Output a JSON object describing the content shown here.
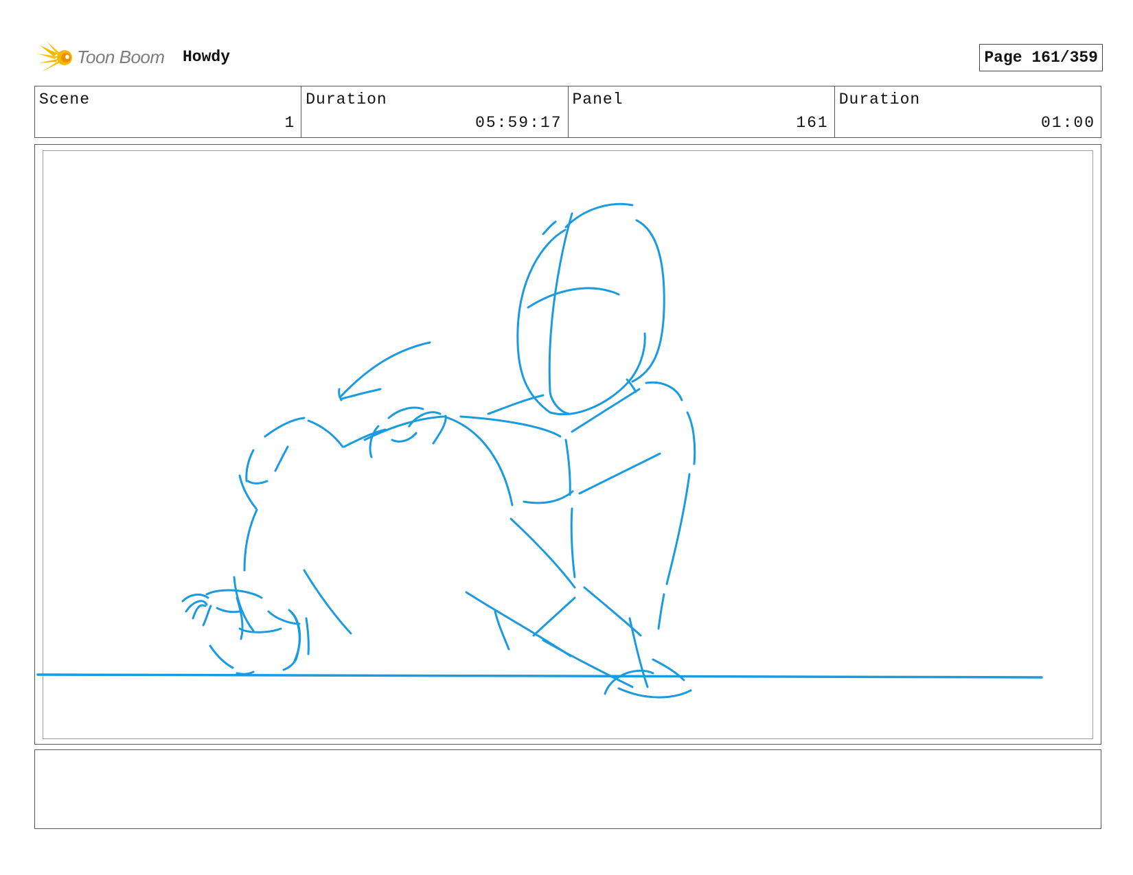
{
  "header": {
    "logo_text": "Toon Boom",
    "project_title": "Howdy",
    "page_label": "Page 161/359"
  },
  "info": [
    {
      "label": "Scene",
      "value": "1"
    },
    {
      "label": "Duration",
      "value": "05:59:17"
    },
    {
      "label": "Panel",
      "value": "161"
    },
    {
      "label": "Duration",
      "value": "01:00"
    }
  ],
  "colors": {
    "sketch_stroke": "#1a9be0",
    "logo_yellow": "#f5b800",
    "logo_orange": "#f08c00",
    "border": "#555555"
  },
  "notes": {
    "text": ""
  }
}
